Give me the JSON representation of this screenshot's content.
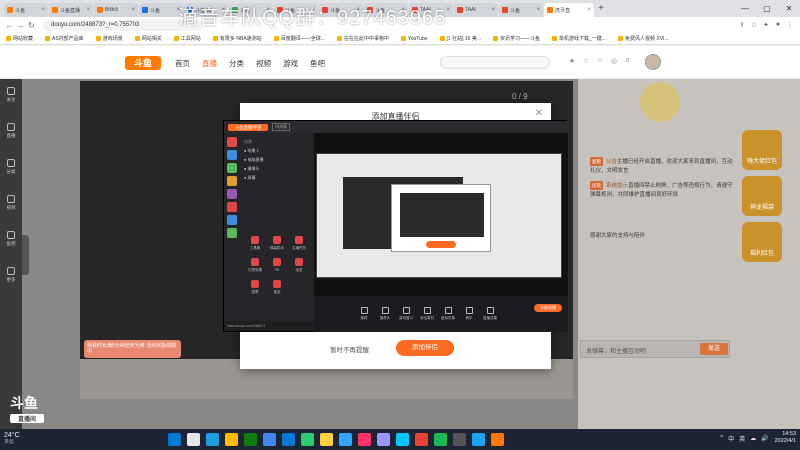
{
  "browser": {
    "tabs": [
      {
        "title": "斗鱼",
        "color": "#ff7a00",
        "active": false
      },
      {
        "title": "斗鱼直播",
        "color": "#ff7a00",
        "active": false
      },
      {
        "title": "Bilibili",
        "color": "#ff7a00",
        "active": false
      },
      {
        "title": "斗鱼",
        "color": "#1a73e8",
        "active": false
      },
      {
        "title": "斗鱼-每",
        "color": "#1a73e8",
        "active": false
      },
      {
        "title": "斗鱼",
        "color": "#34a853",
        "active": false
      },
      {
        "title": "斗鱼",
        "color": "#ea4335",
        "active": false
      },
      {
        "title": "斗鱼",
        "color": "#ea4335",
        "active": false
      },
      {
        "title": "斗鱼",
        "color": "#ea4335",
        "active": false
      },
      {
        "title": "TAAI",
        "color": "#ea4335",
        "active": false
      },
      {
        "title": "TAAI",
        "color": "#ea4335",
        "active": false
      },
      {
        "title": "斗鱼",
        "color": "#ea4335",
        "active": false
      },
      {
        "title": "虎牙直",
        "color": "#ff7a00",
        "active": true
      }
    ],
    "url": "douyu.com/248873?_r=0.755703",
    "bookmarks": [
      "网站收藏",
      "AS内部产品库",
      "游戏场景",
      "网站相关",
      "工具网站",
      "有限多·NBA速测站",
      "百度翻译——全球...",
      "在在在此中中事物中",
      "YouTube",
      "[1 社站] 16 美...",
      "资讯学习——斗鱼",
      "单机游戏下载_一键...",
      "免费风人视频 XVI..."
    ]
  },
  "overlay": {
    "qq_text": "滴音车队QQ群：927463965"
  },
  "site": {
    "logo": "斗鱼",
    "nav": [
      "首页",
      "直播",
      "分类",
      "视频",
      "游戏",
      "鱼吧"
    ],
    "active_nav": 1,
    "icons": [
      "★",
      "☆",
      "⌂",
      "◎",
      "♬"
    ]
  },
  "left_rail": [
    "关注",
    "直播",
    "分类",
    "视频",
    "鱼吧",
    "更多"
  ],
  "video": {
    "counter": "0 / 9"
  },
  "gift_badge": "观看时长满5分钟送荧光棒 活动奖励领取中",
  "chat": {
    "lines": [
      {
        "tag": "超管",
        "user": "公告",
        "text": "主播已经开启直播，欢迎大家来到直播间，互动礼仪，文明发言"
      },
      {
        "tag": "房管",
        "user": "系统提示",
        "text": "直播间禁止刷屏、广告等违规行为，请遵守弹幕规则，共同维护直播间良好环境"
      },
      {
        "tag": "",
        "user": "",
        "text": "感谢大家的支持与陪伴"
      }
    ],
    "input_placeholder": "发弹幕，和主播互动吧",
    "send_label": "发送"
  },
  "side_gifts": [
    "嗨大佬红包",
    "神龙福袋",
    "福利红包"
  ],
  "modal": {
    "title": "添加直播伴侣",
    "later_label": "暂时不再提醒",
    "add_label": "添加伴侣",
    "app": {
      "logo": "斗鱼直播伴侣",
      "version": "内测版",
      "scenes_header": "场景",
      "scenes": [
        "● 场景 1",
        "● 电脑直播",
        "● 摄像头",
        "● 屏幕"
      ],
      "tools": [
        "工具箱",
        "弹幕助手",
        "主播任务",
        "礼物效果",
        "PK",
        "连麦",
        "投票",
        "抽奖"
      ],
      "footer": [
        "美颜",
        "摄像头",
        "游戏窗口",
        "添加素材",
        "虚拟形象",
        "音乐",
        "直播设置"
      ],
      "live_label": "开始直播",
      "url": "www.douyu.com/248873"
    }
  },
  "bottom_logo": {
    "main": "斗鱼",
    "sub": "直播间"
  },
  "taskbar": {
    "weather_temp": "24°C",
    "weather_label": "多云",
    "app_colors": [
      "#0078d4",
      "#e6e6e6",
      "#1ba1e2",
      "#ffb900",
      "#107c10",
      "#4285f4",
      "#0078d4",
      "#2ecc71",
      "#ffd23f",
      "#31a8ff",
      "#ff3366",
      "#9999ff",
      "#00c8ff",
      "#ea4335",
      "#1db954",
      "#555",
      "#1da1f2",
      "#ff7a00"
    ],
    "tray": [
      "^",
      "中",
      "英",
      "☁",
      "🔊"
    ],
    "time": "14:53",
    "date": "2022/4/1"
  }
}
